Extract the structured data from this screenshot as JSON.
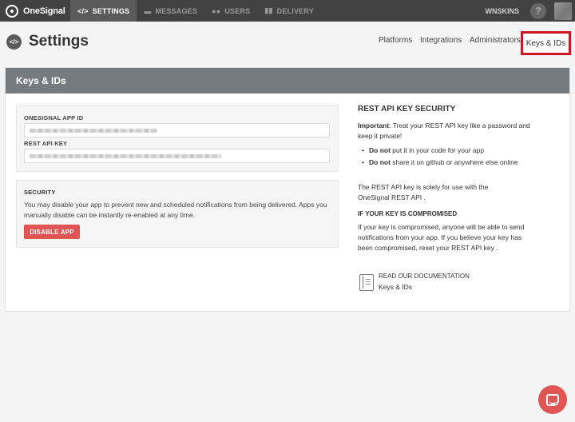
{
  "topbar": {
    "brand": "OneSignal",
    "tabs": [
      {
        "icon": "</>",
        "label": "SETTINGS"
      },
      {
        "icon": "▬",
        "label": "MESSAGES"
      },
      {
        "icon": "●●",
        "label": "USERS"
      },
      {
        "icon": "▮▮",
        "label": "DELIVERY"
      }
    ],
    "user": "WNSKINS",
    "help": "?"
  },
  "header": {
    "icon": "</>",
    "title": "Settings",
    "subnav": [
      "Platforms",
      "Integrations",
      "Administrators",
      "Keys & IDs"
    ]
  },
  "card": {
    "title": "Keys & IDs",
    "app_id_label": "ONESIGNAL APP ID",
    "rest_key_label": "REST API KEY",
    "security": {
      "title": "SECURITY",
      "text": "You may disable your app to prevent new and scheduled notifications from being delivered. Apps you manually disable can be instantly re-enabled at any time.",
      "button": "DISABLE APP"
    }
  },
  "info": {
    "title": "REST API KEY SECURITY",
    "important_label": "Important",
    "important_text": ": Treat your REST API key like a password and keep it private!",
    "bullets": [
      {
        "bold": "Do not",
        "text": " put it in your code for your app"
      },
      {
        "bold": "Do not",
        "text": " share it on github or anywhere else online"
      }
    ],
    "usage": "The REST API key is solely for use with the OneSignal REST API .",
    "compromised_title": "IF YOUR KEY IS COMPROMISED",
    "compromised_text": "If your key is compromised, anyone will be able to send notifications from your app. If you believe your key has been compromised, reset your REST API key .",
    "doc_title": "READ OUR DOCUMENTATION",
    "doc_link": "Keys & IDs"
  },
  "colors": {
    "topbar": "#424242",
    "card_header": "#767b80",
    "danger": "#e05454",
    "highlight": "#d0172a"
  }
}
